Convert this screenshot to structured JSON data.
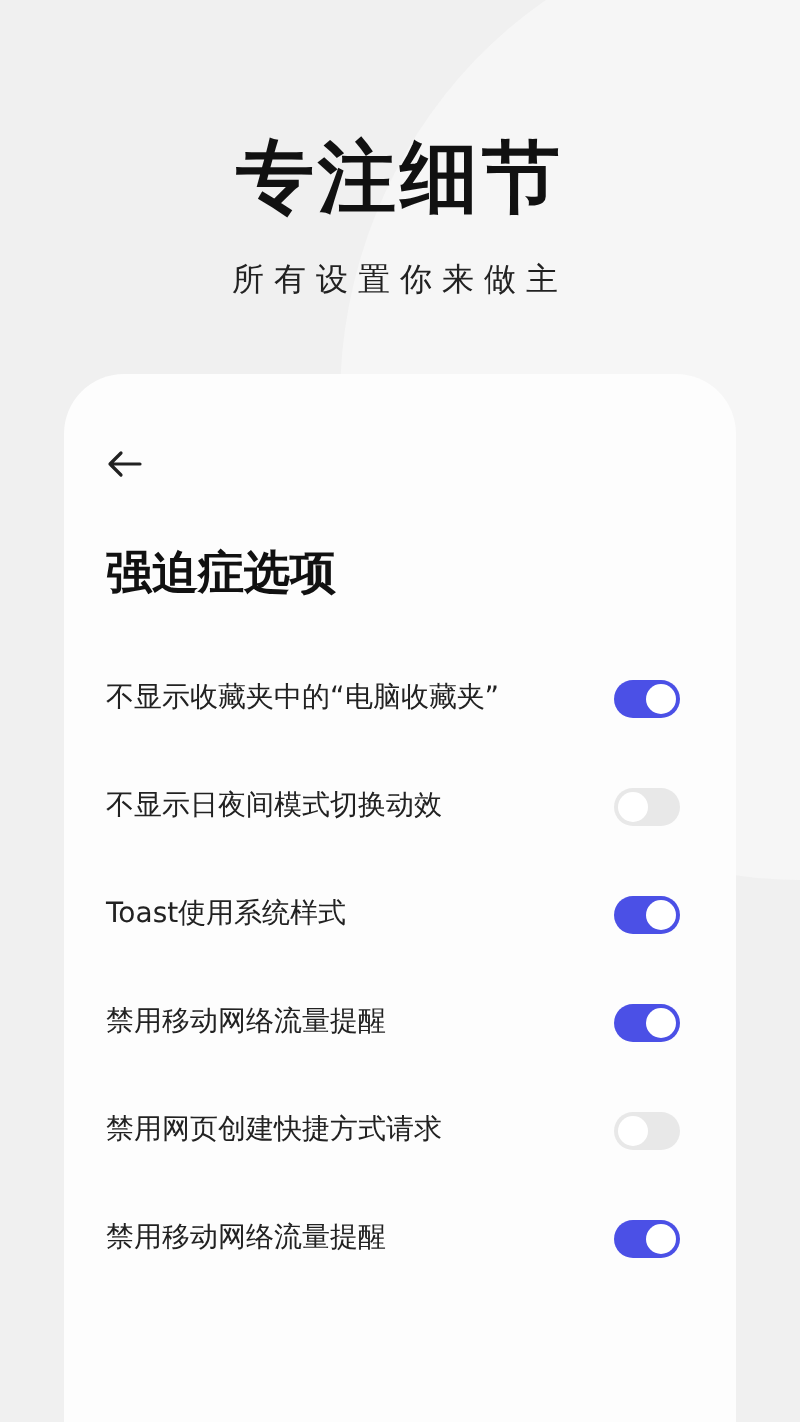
{
  "headline": "专注细节",
  "subheadline": "所有设置你来做主",
  "screen": {
    "title": "强迫症选项",
    "options": [
      {
        "label": "不显示收藏夹中的“电脑收藏夹”",
        "on": true
      },
      {
        "label": "不显示日夜间模式切换动效",
        "on": false
      },
      {
        "label": "Toast使用系统样式",
        "on": true
      },
      {
        "label": "禁用移动网络流量提醒",
        "on": true
      },
      {
        "label": "禁用网页创建快捷方式请求",
        "on": false
      },
      {
        "label": "禁用移动网络流量提醒",
        "on": true
      }
    ]
  }
}
